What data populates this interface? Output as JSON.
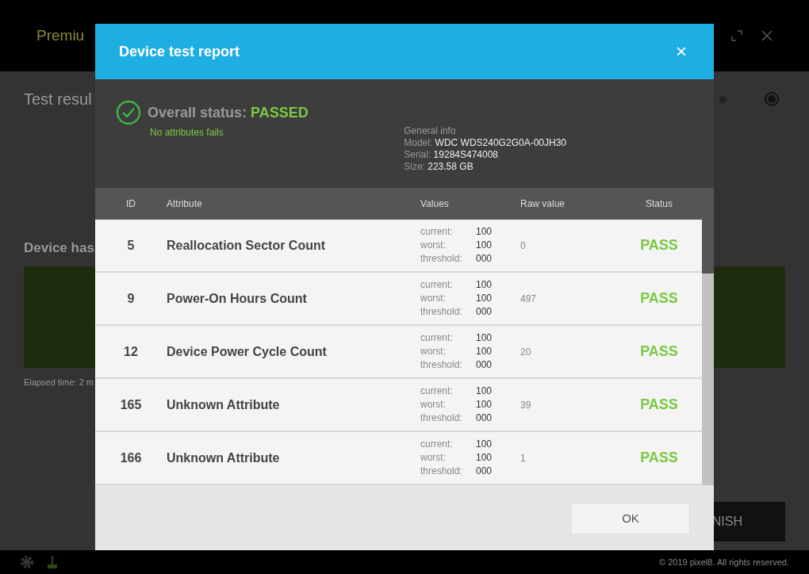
{
  "background": {
    "app_title": "Premiu",
    "section_title": "Test resul",
    "steps": [
      {
        "selected": false
      },
      {
        "selected": true
      }
    ],
    "device_heading": "Device has",
    "elapsed": "Elapsed time: 2 m",
    "finish_button": "NISH",
    "copyright": "© 2019 pixel8. All rights reserved."
  },
  "dialog": {
    "title": "Device test report",
    "close": "×",
    "overall": {
      "label": "Overall status:",
      "value": "PASSED",
      "passed": true,
      "note": "No attributes fails"
    },
    "general_info": {
      "heading": "General info",
      "fields": [
        {
          "label": "Model:",
          "value": "WDC WDS240G2G0A-00JH30"
        },
        {
          "label": "Serial:",
          "value": "19284S474008"
        },
        {
          "label": "Size:",
          "value": "223.58 GB"
        }
      ]
    },
    "columns": [
      "ID",
      "Attribute",
      "Values",
      "Raw value",
      "Status"
    ],
    "rows": [
      {
        "id": "5",
        "attribute": "Reallocation Sector Count",
        "values": [
          {
            "label": "current:",
            "value": "100"
          },
          {
            "label": "worst:",
            "value": "100"
          },
          {
            "label": "threshold:",
            "value": "000"
          }
        ],
        "raw": "0",
        "status": "PASS",
        "passed": true
      },
      {
        "id": "9",
        "attribute": "Power-On Hours Count",
        "values": [
          {
            "label": "current:",
            "value": "100"
          },
          {
            "label": "worst:",
            "value": "100"
          },
          {
            "label": "threshold:",
            "value": "000"
          }
        ],
        "raw": "497",
        "status": "PASS",
        "passed": true
      },
      {
        "id": "12",
        "attribute": "Device Power Cycle Count",
        "values": [
          {
            "label": "current:",
            "value": "100"
          },
          {
            "label": "worst:",
            "value": "100"
          },
          {
            "label": "threshold:",
            "value": "000"
          }
        ],
        "raw": "20",
        "status": "PASS",
        "passed": true
      },
      {
        "id": "165",
        "attribute": "Unknown Attribute",
        "values": [
          {
            "label": "current:",
            "value": "100"
          },
          {
            "label": "worst:",
            "value": "100"
          },
          {
            "label": "threshold:",
            "value": "000"
          }
        ],
        "raw": "39",
        "status": "PASS",
        "passed": true
      },
      {
        "id": "166",
        "attribute": "Unknown Attribute",
        "values": [
          {
            "label": "current:",
            "value": "100"
          },
          {
            "label": "worst:",
            "value": "100"
          },
          {
            "label": "threshold:",
            "value": "000"
          }
        ],
        "raw": "1",
        "status": "PASS",
        "passed": true
      }
    ],
    "ok_button": "OK"
  }
}
